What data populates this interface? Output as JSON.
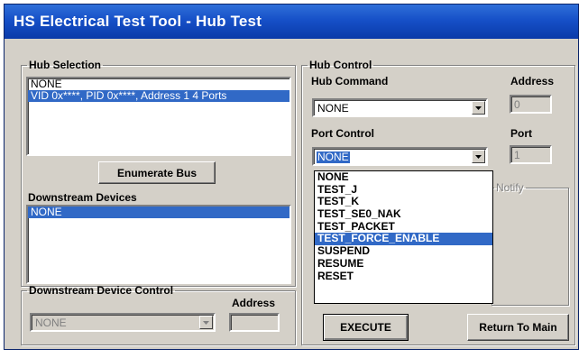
{
  "window": {
    "title": "HS Electrical Test Tool - Hub Test"
  },
  "hub_selection": {
    "legend": "Hub Selection",
    "items": [
      {
        "label": "NONE",
        "selected": false
      },
      {
        "label": "VID 0x****, PID 0x****, Address 1  4 Ports",
        "selected": true
      }
    ],
    "enumerate_button": "Enumerate Bus",
    "downstream_label": "Downstream Devices",
    "downstream_items": [
      {
        "label": "NONE",
        "selected": true
      }
    ]
  },
  "downstream_control": {
    "legend": "Downstream Device Control",
    "address_label": "Address",
    "device_combo_value": "NONE",
    "address_value": ""
  },
  "hub_control": {
    "legend": "Hub Control",
    "hub_command_label": "Hub Command",
    "hub_command_value": "NONE",
    "address_label": "Address",
    "address_value": "0",
    "port_control_label": "Port Control",
    "port_control_value": "NONE",
    "port_label": "Port",
    "port_value": "1",
    "notify_label": "Notify",
    "port_control_options": [
      "NONE",
      "TEST_J",
      "TEST_K",
      "TEST_SE0_NAK",
      "TEST_PACKET",
      "TEST_FORCE_ENABLE",
      "SUSPEND",
      "RESUME",
      "RESET"
    ],
    "highlighted_option": "TEST_FORCE_ENABLE",
    "execute_button": "EXECUTE",
    "return_button": "Return To Main"
  },
  "colors": {
    "selection": "#3169c6",
    "titlebar": "#1650c8",
    "face": "#d4d0c8"
  }
}
